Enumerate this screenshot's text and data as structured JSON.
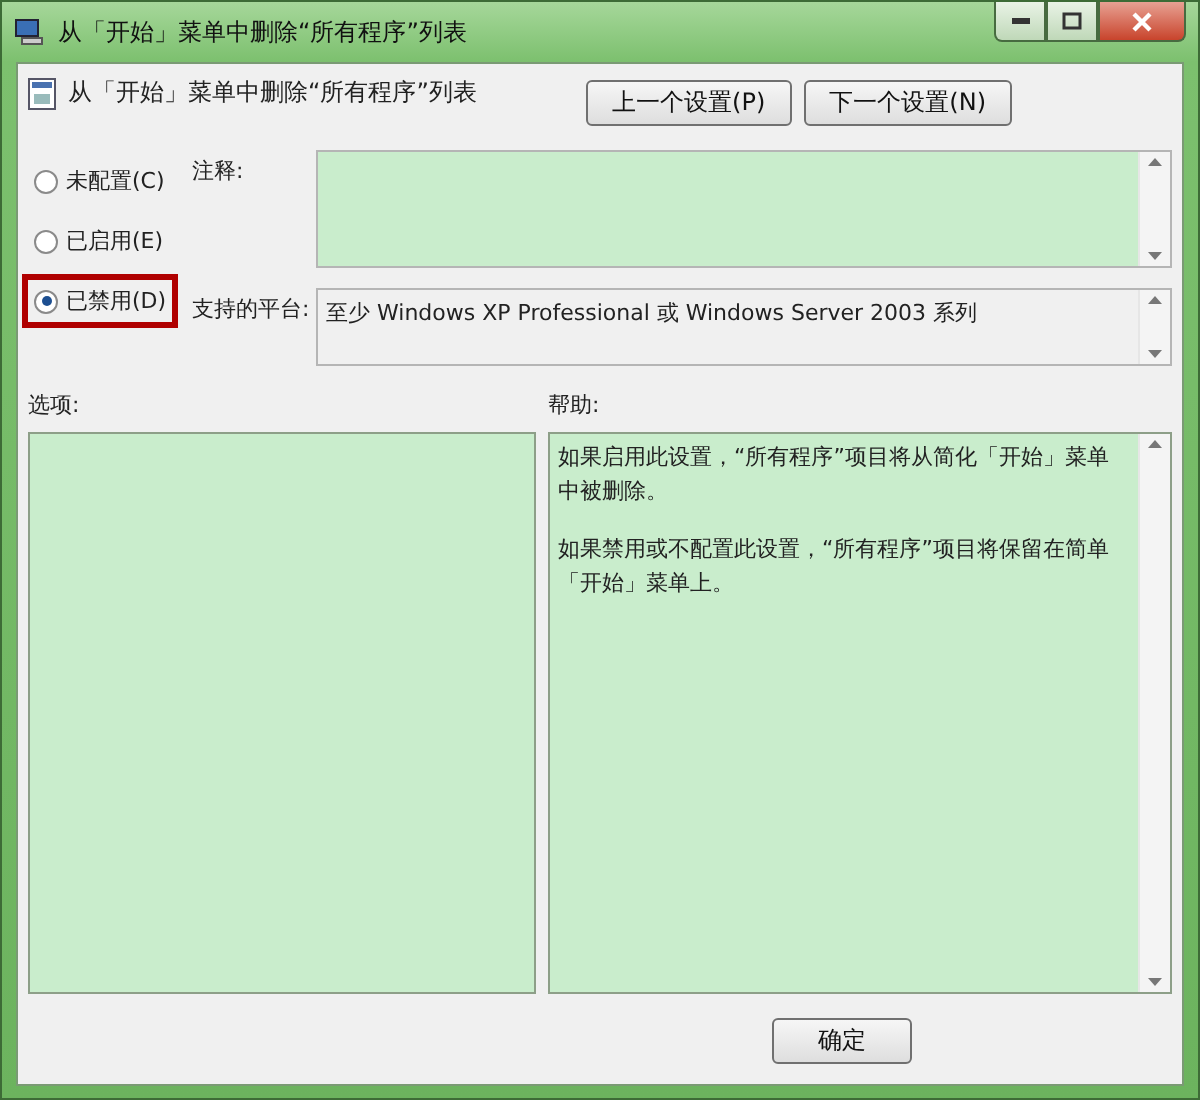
{
  "window": {
    "title": "从「开始」菜单中删除“所有程序”列表"
  },
  "policy": {
    "title": "从「开始」菜单中删除“所有程序”列表"
  },
  "nav_buttons": [
    {
      "label": "上一个设置(P)"
    },
    {
      "label": "下一个设置(N)"
    }
  ],
  "states": [
    {
      "label": "未配置(C)",
      "selected": false,
      "highlighted": false
    },
    {
      "label": "已启用(E)",
      "selected": false,
      "highlighted": false
    },
    {
      "label": "已禁用(D)",
      "selected": true,
      "highlighted": true
    }
  ],
  "comment": {
    "label": "注释:"
  },
  "platform": {
    "label": "支持的平台:",
    "value": "至少 Windows XP Professional 或 Windows Server 2003 系列"
  },
  "options": {
    "label": "选项:"
  },
  "help": {
    "label": "帮助:",
    "paragraphs": [
      "如果启用此设置，“所有程序”项目将从简化「开始」菜单中被删除。",
      "如果禁用或不配置此设置，“所有程序”项目将保留在简单「开始」菜单上。"
    ]
  },
  "footer_buttons": [
    {
      "label": "确定"
    }
  ]
}
